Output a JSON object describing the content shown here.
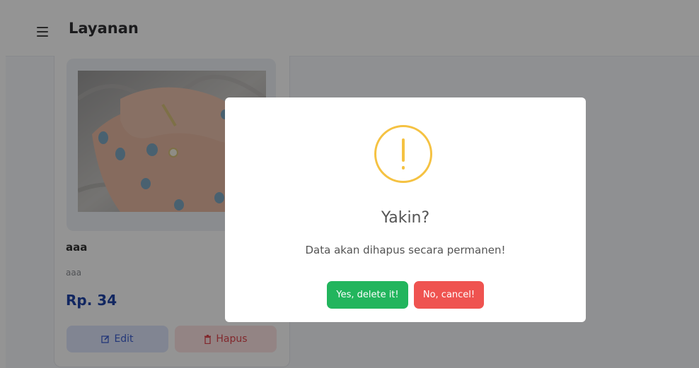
{
  "header": {
    "title": "Layanan",
    "menu_icon": "hamburger-menu-icon"
  },
  "service_card": {
    "name": "aaa",
    "description": "aaa",
    "price": "Rp. 34",
    "edit_label": "Edit",
    "edit_icon": "edit-icon",
    "delete_label": "Hapus",
    "delete_icon": "trash-icon"
  },
  "dialog": {
    "icon": "warning-icon",
    "title": "Yakin?",
    "text": "Data akan dihapus secara permanen!",
    "confirm_label": "Yes, delete it!",
    "cancel_label": "No, cancel!"
  },
  "colors": {
    "accent_blue": "#1f44a8",
    "confirm_green": "#22b55d",
    "cancel_red": "#ef5350",
    "warning_yellow": "#f5c242"
  }
}
